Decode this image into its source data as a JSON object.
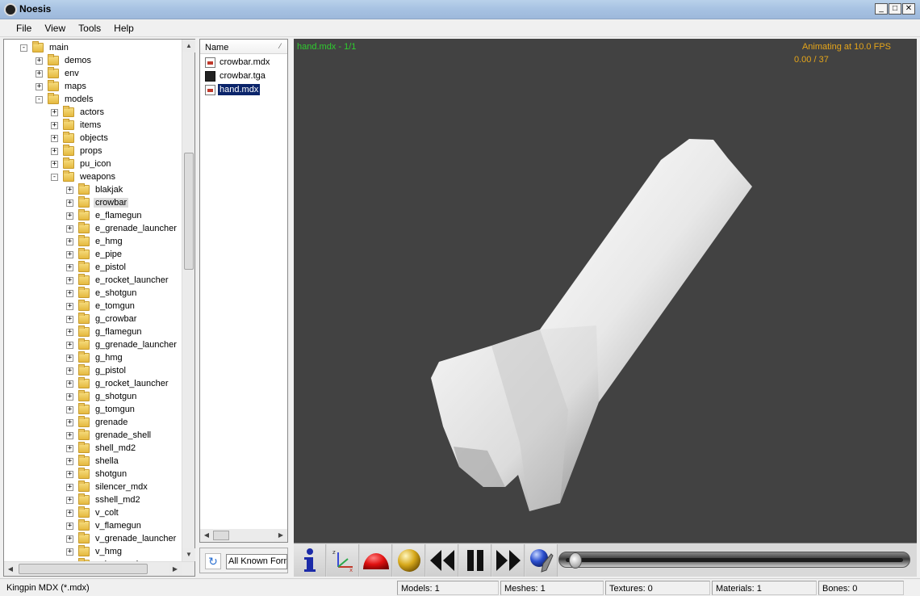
{
  "window": {
    "title": "Noesis"
  },
  "menu": [
    "File",
    "View",
    "Tools",
    "Help"
  ],
  "tree": [
    {
      "label": "main",
      "depth": 0,
      "expander": "-"
    },
    {
      "label": "demos",
      "depth": 1,
      "expander": "+"
    },
    {
      "label": "env",
      "depth": 1,
      "expander": "+"
    },
    {
      "label": "maps",
      "depth": 1,
      "expander": "+"
    },
    {
      "label": "models",
      "depth": 1,
      "expander": "-"
    },
    {
      "label": "actors",
      "depth": 2,
      "expander": "+"
    },
    {
      "label": "items",
      "depth": 2,
      "expander": "+"
    },
    {
      "label": "objects",
      "depth": 2,
      "expander": "+"
    },
    {
      "label": "props",
      "depth": 2,
      "expander": "+"
    },
    {
      "label": "pu_icon",
      "depth": 2,
      "expander": "+"
    },
    {
      "label": "weapons",
      "depth": 2,
      "expander": "-"
    },
    {
      "label": "blakjak",
      "depth": 3,
      "expander": "+"
    },
    {
      "label": "crowbar",
      "depth": 3,
      "expander": "+",
      "selected": true
    },
    {
      "label": "e_flamegun",
      "depth": 3,
      "expander": "+"
    },
    {
      "label": "e_grenade_launcher",
      "depth": 3,
      "expander": "+"
    },
    {
      "label": "e_hmg",
      "depth": 3,
      "expander": "+"
    },
    {
      "label": "e_pipe",
      "depth": 3,
      "expander": "+"
    },
    {
      "label": "e_pistol",
      "depth": 3,
      "expander": "+"
    },
    {
      "label": "e_rocket_launcher",
      "depth": 3,
      "expander": "+"
    },
    {
      "label": "e_shotgun",
      "depth": 3,
      "expander": "+"
    },
    {
      "label": "e_tomgun",
      "depth": 3,
      "expander": "+"
    },
    {
      "label": "g_crowbar",
      "depth": 3,
      "expander": "+"
    },
    {
      "label": "g_flamegun",
      "depth": 3,
      "expander": "+"
    },
    {
      "label": "g_grenade_launcher",
      "depth": 3,
      "expander": "+"
    },
    {
      "label": "g_hmg",
      "depth": 3,
      "expander": "+"
    },
    {
      "label": "g_pistol",
      "depth": 3,
      "expander": "+"
    },
    {
      "label": "g_rocket_launcher",
      "depth": 3,
      "expander": "+"
    },
    {
      "label": "g_shotgun",
      "depth": 3,
      "expander": "+"
    },
    {
      "label": "g_tomgun",
      "depth": 3,
      "expander": "+"
    },
    {
      "label": "grenade",
      "depth": 3,
      "expander": "+"
    },
    {
      "label": "grenade_shell",
      "depth": 3,
      "expander": "+"
    },
    {
      "label": "shell_md2",
      "depth": 3,
      "expander": "+"
    },
    {
      "label": "shella",
      "depth": 3,
      "expander": "+"
    },
    {
      "label": "shotgun",
      "depth": 3,
      "expander": "+"
    },
    {
      "label": "silencer_mdx",
      "depth": 3,
      "expander": "+"
    },
    {
      "label": "sshell_md2",
      "depth": 3,
      "expander": "+"
    },
    {
      "label": "v_colt",
      "depth": 3,
      "expander": "+"
    },
    {
      "label": "v_flamegun",
      "depth": 3,
      "expander": "+"
    },
    {
      "label": "v_grenade_launcher",
      "depth": 3,
      "expander": "+"
    },
    {
      "label": "v_hmg",
      "depth": 3,
      "expander": "+"
    },
    {
      "label": "v_hmgcool",
      "depth": 3,
      "expander": "+"
    }
  ],
  "files": {
    "header": "Name",
    "items": [
      {
        "label": "crowbar.mdx",
        "icon": "mdx-file-icon"
      },
      {
        "label": "crowbar.tga",
        "icon": "tga-file-icon"
      },
      {
        "label": "hand.mdx",
        "icon": "mdx-file-icon",
        "selected": true
      }
    ]
  },
  "filter": {
    "value": "All Known Formats"
  },
  "viewport": {
    "file_info": "hand.mdx - 1/1",
    "anim_info": "Animating at 10.0 FPS",
    "frame_info": "0.00 / 37",
    "background": "#424242"
  },
  "toolbar": {
    "buttons": [
      "info-icon",
      "axes-icon",
      "red-dome-icon",
      "gold-sphere-icon",
      "rewind-icon",
      "pause-icon",
      "fast-forward-icon",
      "globe-tool-icon"
    ],
    "slider_position": 0.0
  },
  "status": {
    "format": "Kingpin MDX (*.mdx)",
    "models": "Models: 1",
    "meshes": "Meshes: 1",
    "textures": "Textures: 0",
    "materials": "Materials: 1",
    "bones": "Bones: 0"
  }
}
